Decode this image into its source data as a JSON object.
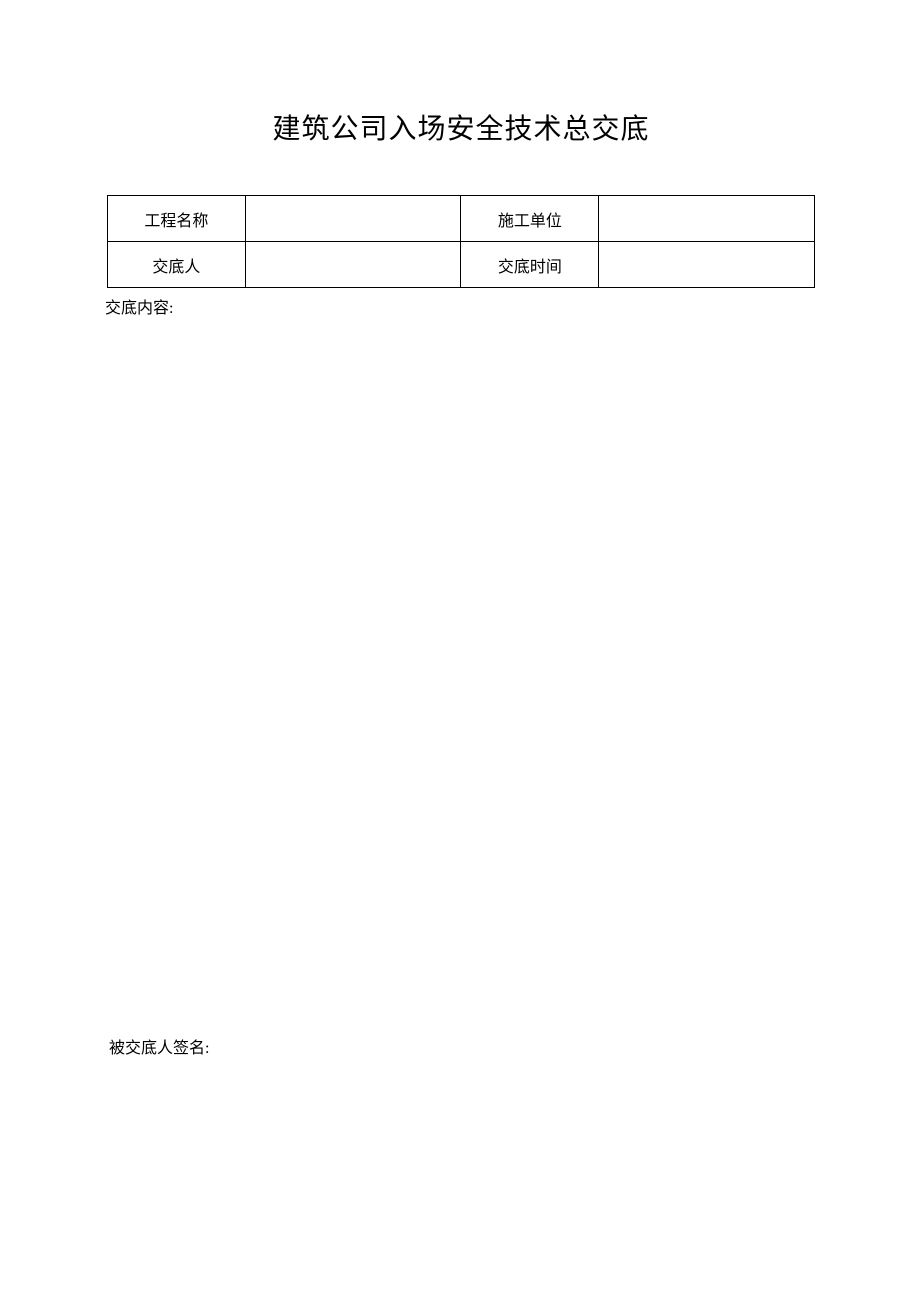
{
  "title": "建筑公司入场安全技术总交底",
  "table": {
    "row1": {
      "label1": "工程名称",
      "value1": "",
      "label2": "施工单位",
      "value2": ""
    },
    "row2": {
      "label1": "交底人",
      "value1": "",
      "label2": "交底时间",
      "value2": ""
    }
  },
  "content_label": "交底内容:",
  "signature_label": "被交底人签名:"
}
